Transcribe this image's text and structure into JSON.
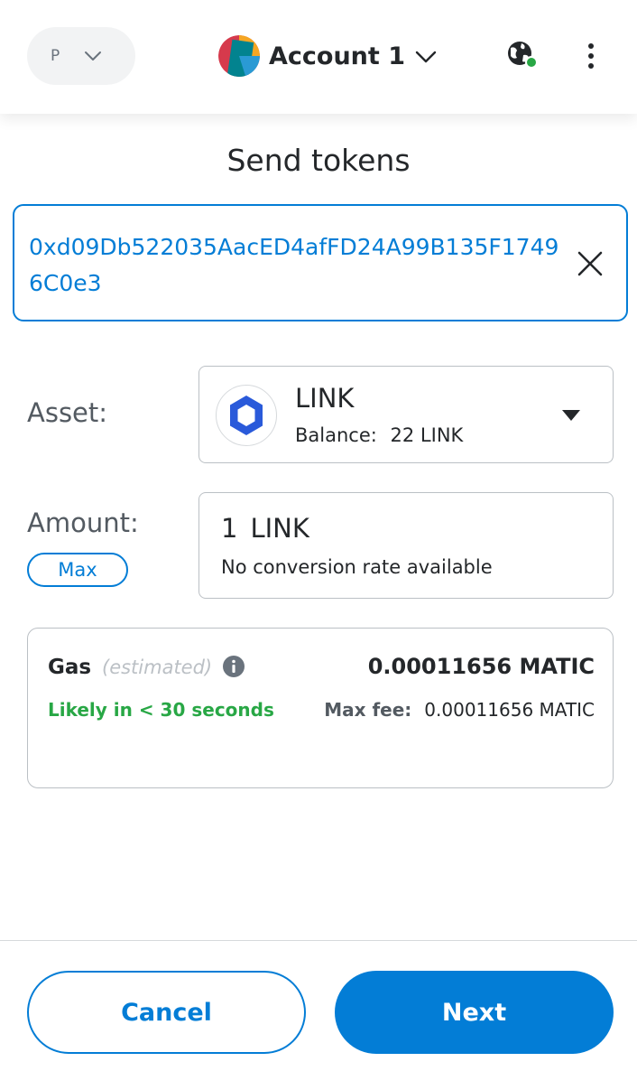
{
  "header": {
    "network_initial": "P",
    "account_name": "Account 1"
  },
  "page": {
    "title": "Send tokens"
  },
  "recipient": {
    "address": "0xd09Db522035AacED4afFD24A99B135F17496C0e3"
  },
  "asset": {
    "label": "Asset:",
    "symbol": "LINK",
    "balance_label": "Balance:",
    "balance_value": "22 LINK"
  },
  "amount": {
    "label": "Amount:",
    "max_label": "Max",
    "value": "1",
    "unit": "LINK",
    "conversion": "No conversion rate available"
  },
  "gas": {
    "title": "Gas",
    "estimated": "(estimated)",
    "total": "0.00011656 MATIC",
    "likely": "Likely in < 30 seconds",
    "max_fee_label": "Max fee:",
    "max_fee_value": "0.00011656 MATIC"
  },
  "footer": {
    "cancel_label": "Cancel",
    "next_label": "Next"
  },
  "colors": {
    "primary": "#037dd6",
    "success": "#28a745",
    "link_blue": "#2a5ada",
    "border": "#bbc0c5"
  },
  "icons": {
    "network_dropdown": "chevron-down-icon",
    "account_dropdown": "chevron-down-icon",
    "connection_status": "globe-icon",
    "menu": "kebab-menu-icon",
    "clear_recipient": "close-icon",
    "asset_dropdown": "caret-down-icon",
    "gas_info": "info-icon"
  }
}
